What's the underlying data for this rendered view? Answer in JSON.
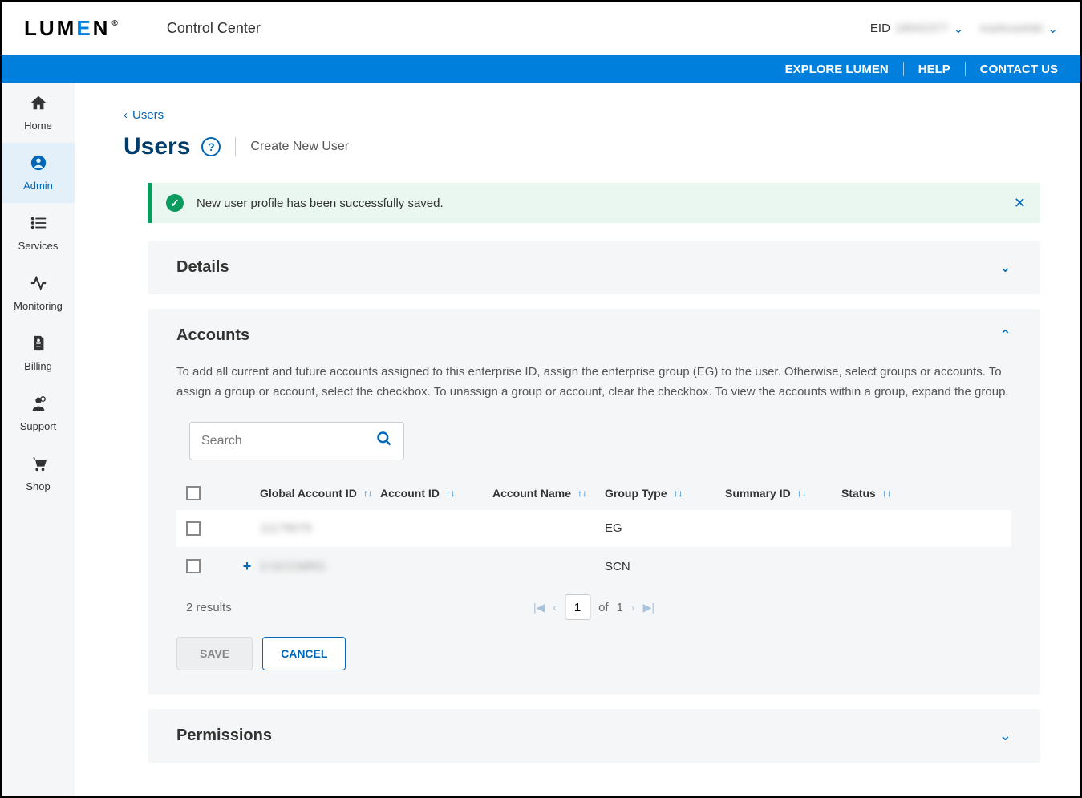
{
  "header": {
    "logo_text": "LUM",
    "logo_e": "E",
    "logo_n": "N",
    "reg": "®",
    "app_name": "Control Center",
    "eid_label": "EID",
    "eid_value": "18042377",
    "username": "markoselski"
  },
  "navbar": {
    "explore": "EXPLORE LUMEN",
    "help": "HELP",
    "contact": "CONTACT US"
  },
  "sidebar": {
    "items": [
      {
        "label": "Home"
      },
      {
        "label": "Admin"
      },
      {
        "label": "Services"
      },
      {
        "label": "Monitoring"
      },
      {
        "label": "Billing"
      },
      {
        "label": "Support"
      },
      {
        "label": "Shop"
      }
    ]
  },
  "breadcrumb": {
    "label": "Users"
  },
  "page": {
    "title": "Users",
    "create_link": "Create New User"
  },
  "alert": {
    "message": "New user profile has been successfully saved."
  },
  "details": {
    "title": "Details"
  },
  "accounts": {
    "title": "Accounts",
    "description": "To add all current and future accounts assigned to this enterprise ID, assign the enterprise group (EG) to the user. Otherwise, select groups or accounts. To assign a group or account, select the checkbox. To unassign a group or account, clear the checkbox. To view the accounts within a group, expand the group.",
    "search_placeholder": "Search",
    "columns": {
      "global_account_id": "Global Account ID",
      "account_id": "Account ID",
      "account_name": "Account Name",
      "group_type": "Group Type",
      "summary_id": "Summary ID",
      "status": "Status"
    },
    "rows": [
      {
        "global_account_id": "11179076",
        "group_type": "EG",
        "expandable": false
      },
      {
        "global_account_id": "2-GCCMRG",
        "group_type": "SCN",
        "expandable": true
      }
    ],
    "results_text": "2 results",
    "page_current": "1",
    "page_of": "of",
    "page_total": "1",
    "save_label": "SAVE",
    "cancel_label": "CANCEL"
  },
  "permissions": {
    "title": "Permissions"
  }
}
